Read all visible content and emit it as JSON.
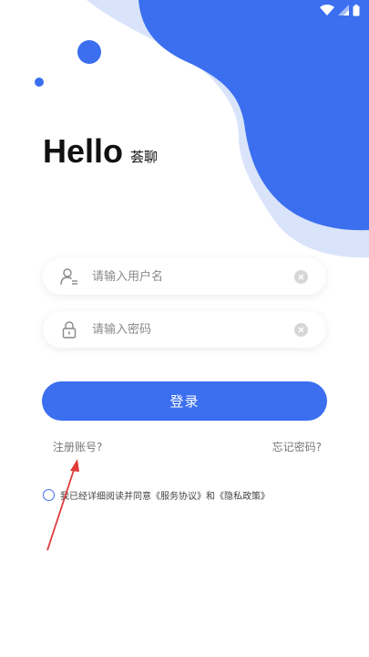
{
  "colors": {
    "accent": "#3b6ff0",
    "blob_dark": "#3b6ff0",
    "blob_light": "#d9e4fb",
    "annotation": "#e03a3a"
  },
  "status_bar": {
    "icons": [
      "wifi-icon",
      "signal-icon",
      "battery-icon"
    ]
  },
  "header": {
    "title": "Hello",
    "subtitle": "荟聊"
  },
  "form": {
    "username": {
      "value": "",
      "placeholder": "请输入用户名",
      "icon": "user-icon"
    },
    "password": {
      "value": "",
      "placeholder": "请输入密码",
      "icon": "lock-icon"
    },
    "login_label": "登录"
  },
  "links": {
    "register": "注册账号?",
    "forgot": "忘记密码?"
  },
  "agreement": {
    "text": "我已经详细阅读并同意《服务协议》和《隐私政策》"
  }
}
